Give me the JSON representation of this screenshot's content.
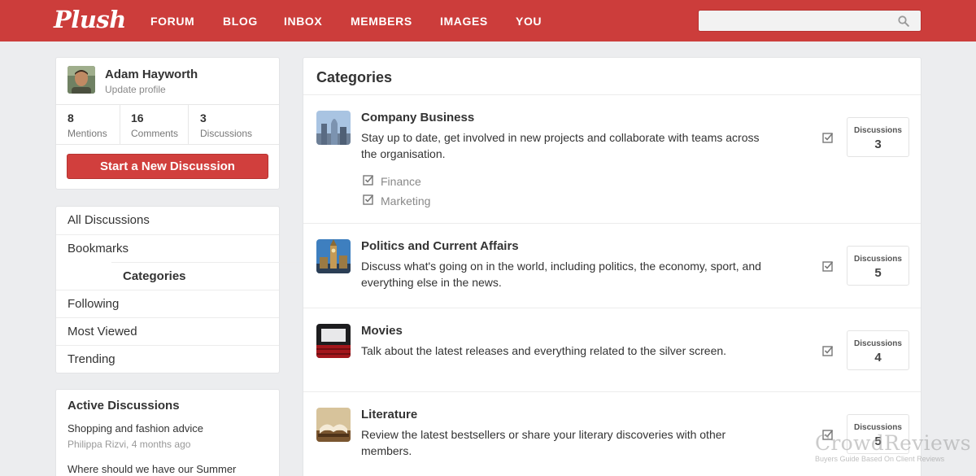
{
  "app": {
    "logo": "Plush"
  },
  "nav": {
    "items": [
      "FORUM",
      "BLOG",
      "INBOX",
      "MEMBERS",
      "IMAGES",
      "YOU"
    ]
  },
  "search": {
    "placeholder": "",
    "icon": "search-icon"
  },
  "profile": {
    "name": "Adam Hayworth",
    "link": "Update profile",
    "stats": [
      {
        "value": "8",
        "label": "Mentions"
      },
      {
        "value": "16",
        "label": "Comments"
      },
      {
        "value": "3",
        "label": "Discussions"
      }
    ],
    "button": "Start a New Discussion"
  },
  "menu": {
    "items": [
      "All Discussions",
      "Bookmarks",
      "Categories",
      "Following",
      "Most Viewed",
      "Trending"
    ],
    "active": "Categories"
  },
  "active_discussions": {
    "title": "Active Discussions",
    "items": [
      {
        "title": "Shopping and fashion advice",
        "meta": "Philippa Rizvi, 4 months ago"
      },
      {
        "title": "Where should we have our Summer",
        "meta": ""
      }
    ]
  },
  "categories": {
    "title": "Categories",
    "items": [
      {
        "title": "Company Business",
        "desc": "Stay up to date, get involved in new projects and collaborate with teams across the organisation.",
        "subs": [
          "Finance",
          "Marketing"
        ],
        "count_label": "Discussions",
        "count": "3"
      },
      {
        "title": "Politics and Current Affairs",
        "desc": "Discuss what's going on in the world, including politics, the economy, sport, and everything else in the news.",
        "subs": [],
        "count_label": "Discussions",
        "count": "5"
      },
      {
        "title": "Movies",
        "desc": "Talk about the latest releases and everything related to the silver screen.",
        "subs": [],
        "count_label": "Discussions",
        "count": "4"
      },
      {
        "title": "Literature",
        "desc": "Review the latest bestsellers or share your literary discoveries with other members.",
        "subs": [],
        "count_label": "Discussions",
        "count": "5"
      }
    ]
  },
  "watermark": {
    "brand": "CrowdReviews",
    "tagline": "Buyers Guide Based On Client Reviews"
  },
  "colors": {
    "brand_red": "#cc3d3b",
    "button_red": "#d13f3d",
    "background": "#ecedef"
  }
}
